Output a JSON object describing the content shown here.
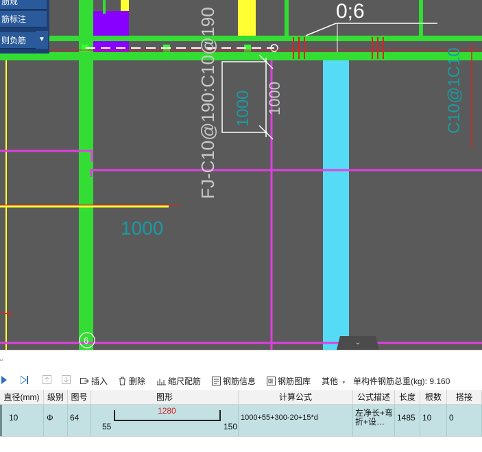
{
  "canvas": {
    "menu_items": [
      "筋规",
      "筋标注",
      "则负筋"
    ],
    "menu_arrow": "▼",
    "texts": {
      "ratio": "0;6",
      "rebar_label_main": "FJ-C10@190:C10@190",
      "rebar_label_right": "C10@1C10",
      "dim_1000_a": "1000",
      "dim_1000_b": "1000",
      "dim_1000_c": "1000",
      "axis_mark": "6",
      "x_mark": "X"
    },
    "colors": {
      "background": "#5a5a5a",
      "beam_green": "#33dd33",
      "column_purple": "#8800ff",
      "yellow": "#ffff33",
      "magenta": "#e040e0",
      "cyan": "#55dbf5",
      "red": "#e02020",
      "teal_text": "#1a9aa3"
    }
  },
  "collapse_icon": "chevron-down-icon",
  "toolbar": {
    "insert": "插入",
    "delete": "删除",
    "scale": "缩尺配筋",
    "rebar_info": "钢筋信息",
    "rebar_lib": "钢筋图库",
    "other": "其他",
    "total_weight_label": "单构件钢筋总重(kg):",
    "total_weight_value": "9.160"
  },
  "grid": {
    "headers": [
      "直径(mm)",
      "级别",
      "图号",
      "图形",
      "计算公式",
      "公式描述",
      "长度",
      "根数",
      "搭接"
    ],
    "row": {
      "diameter": "10",
      "grade": "Φ",
      "figure_no": "64",
      "shape_left": "55",
      "shape_mid": "1280",
      "shape_right": "150",
      "formula": "1000+55+300-20+15*d",
      "description": "左净长+弯折+设…",
      "length": "1485",
      "count": "10",
      "lap": "0"
    }
  }
}
